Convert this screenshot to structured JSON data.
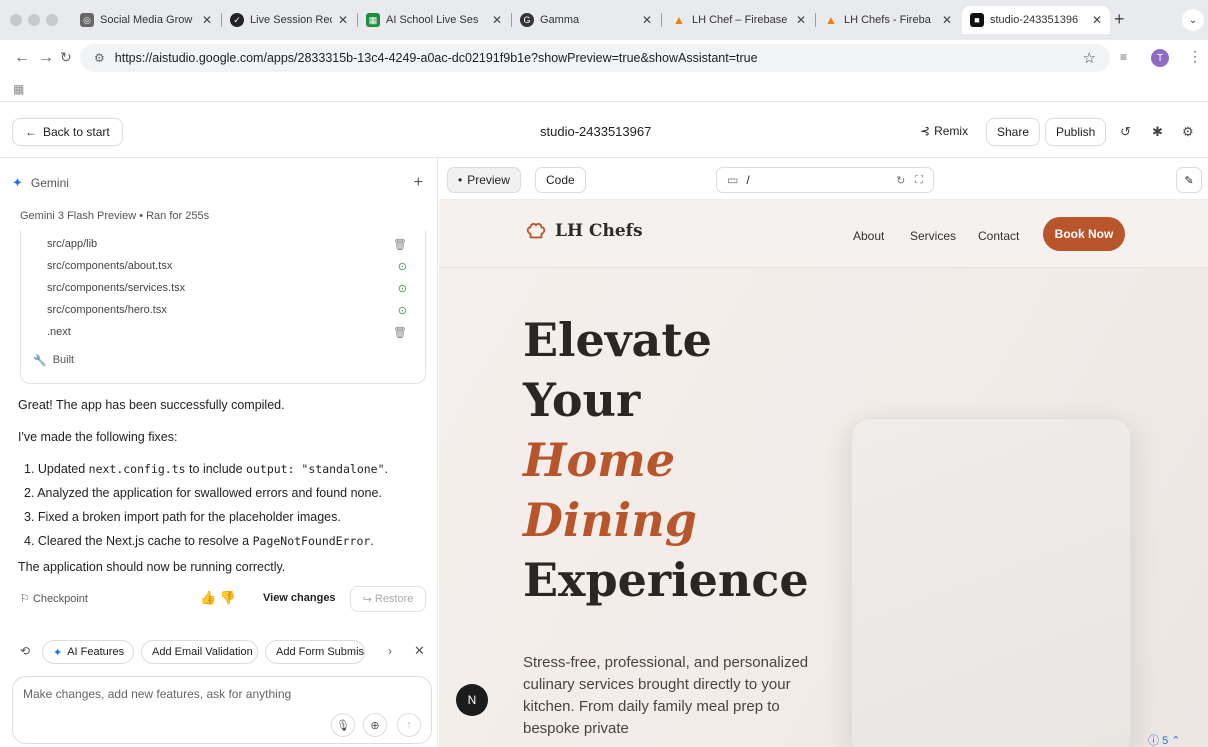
{
  "browser": {
    "tabs": [
      {
        "label": "Social Media Grow",
        "color": "#555"
      },
      {
        "label": "Live Session Reco",
        "color": "#333"
      },
      {
        "label": "AI School Live Ses",
        "color": "#1e8e3e"
      },
      {
        "label": "Gamma",
        "color": "#333"
      },
      {
        "label": "LH Chef – Firebase",
        "color": "#f57c00"
      },
      {
        "label": "LH Chefs - Fireba",
        "color": "#f57c00"
      },
      {
        "label": "studio-243351396",
        "color": "#111"
      }
    ],
    "url": "https://aistudio.google.com/apps/2833315b-13c4-4249-a0ac-dc02191f9b1e?showPreview=true&showAssistant=true",
    "avatar_initial": "T"
  },
  "header": {
    "back_label": "Back to start",
    "project_title": "studio-2433513967",
    "remix_label": "Remix",
    "share_label": "Share",
    "publish_label": "Publish"
  },
  "assistant": {
    "name": "Gemini",
    "meta": "Gemini 3 Flash Preview  •  Ran for 255s",
    "files": [
      {
        "path": "src/app/lib",
        "status": "deleted"
      },
      {
        "path": "src/components/about.tsx",
        "status": "done"
      },
      {
        "path": "src/components/services.tsx",
        "status": "done"
      },
      {
        "path": "src/components/hero.tsx",
        "status": "done"
      },
      {
        "path": ".next",
        "status": "deleted"
      }
    ],
    "built_label": "Built",
    "intro": "Great! The app has been successfully compiled.",
    "fixes_heading": "I've made the following fixes:",
    "fix1_prefix": "1. Updated ",
    "fix1_code1": "next.config.ts",
    "fix1_mid": " to include ",
    "fix1_code2": "output: \"standalone\"",
    "fix1_suffix": ".",
    "fix2": "2. Analyzed the application for swallowed errors and found none.",
    "fix3": "3. Fixed a broken import path for the placeholder images.",
    "fix4_prefix": "4. Cleared the Next.js cache to resolve a ",
    "fix4_code": "PageNotFoundError",
    "fix4_suffix": ".",
    "closing": "The application should now be running correctly.",
    "checkpoint_label": "Checkpoint",
    "view_changes_label": "View changes",
    "restore_label": "Restore",
    "chips": [
      "AI Features",
      "Add Email Validation",
      "Add Form Submissi"
    ],
    "composer_placeholder": "Make changes, add new features, ask for anything"
  },
  "preview": {
    "tab_preview": "Preview",
    "tab_code": "Code",
    "path": "/",
    "site": {
      "brand": "LH Chefs",
      "nav": [
        "About",
        "Services",
        "Contact"
      ],
      "cta": "Book Now",
      "hero_lines": [
        "Elevate",
        "Your",
        "Home",
        "Dining",
        "Experience"
      ],
      "subtitle": "Stress-free, professional, and personalized culinary services brought directly to your kitchen. From daily family meal prep to bespoke private"
    },
    "badge": "N",
    "issue_count": "5"
  },
  "colors": {
    "accent": "#b8552a",
    "gemini": "#1a73e8"
  }
}
